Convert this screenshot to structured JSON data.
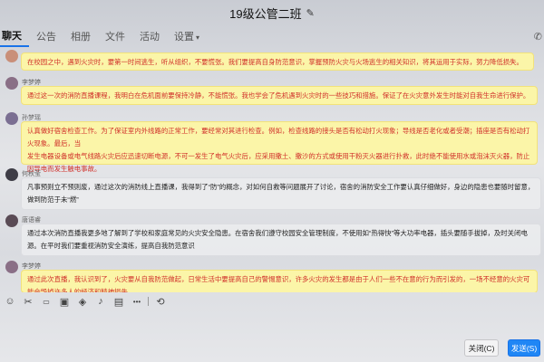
{
  "header": {
    "title": "19级公管二班",
    "edit_icon": "pencil-icon"
  },
  "tabs": [
    {
      "label": "聊天"
    },
    {
      "label": "公告"
    },
    {
      "label": "相册"
    },
    {
      "label": "文件"
    },
    {
      "label": "活动"
    },
    {
      "label": "设置"
    }
  ],
  "messages": [
    {
      "sender": "",
      "lines": [
        "在校园之中，遇到火灾时，要第一时间逃生，听从组织，不要慌张。我们要提高自身防范意识，掌握预防火灾与火场逃生的相关知识，将其运用于实际，努力降低损失。"
      ],
      "style": "hl"
    },
    {
      "sender": "李梦婷",
      "lines": [
        "通过这一次的消防直播课程，我明白在危机面前要保持冷静，不能慌张。我也学会了危机遇到火灾时的一些技巧和措施。保证了在火灾意外发生时能对自我生命进行保护。"
      ],
      "style": "hl"
    },
    {
      "sender": "孙梦瑶",
      "lines": [
        "认真做好宿舍检查工作。为了保证室内外线路的正常工作，要经常对其进行检查。例如，检查线路的接头是否有松动打火现象；导线是否老化或者受潮；插座是否有松动打火现象。最后，当",
        "发生电器设备或电气线路火灾后应迅速切断电源，不可一发生了电气火灾后，应采用撒土、撒沙的方式或使用干粉灭火器进行扑救，此时绝不能使用水或泡沫灭火器，防止因导电而发生触电事故。"
      ],
      "style": "hl"
    },
    {
      "sender": "何秋莹",
      "lines": [
        "凡事预则立不预则废，通过这次的消防线上直播课，我得到了“防”的概念，对如何自救等问题展开了讨论，宿舍的消防安全工作要认真仔细做好，身边的隐患也要随时留意，",
        "做到防范于未“燃”"
      ],
      "style": "normal"
    },
    {
      "sender": "唐语睿",
      "lines": [
        "通过本次消防直播我更多地了解到了学校和家庭常见的火灾安全隐患。在宿舍我们遵守校园安全管理制度，不使用如“热得快”等大功率电器，插头要随手拔掉，及时关闭电",
        "源。在平时我们要重视消防安全演练，提高自我防范意识"
      ],
      "style": "normal"
    },
    {
      "sender": "李梦婷",
      "lines": [
        "通过此次直播，我认识到了，火灾要从自我防范做起，日常生活中要提高自己的警惕意识，许多火灾的发生都是由于人们一些不在意的行为而引发的，一场不经意的火灾可能会毁掉许多人的经济和精神损失"
      ],
      "style": "hl"
    }
  ],
  "toolbar": {
    "icons": [
      "smiley-icon",
      "scissors-icon",
      "folder-icon",
      "image-icon",
      "stamp-icon",
      "mic-icon",
      "card-icon",
      "more-icon",
      "history-icon"
    ]
  },
  "buttons": {
    "close_label": "关闭(C)",
    "send_label": "发送(S)"
  }
}
